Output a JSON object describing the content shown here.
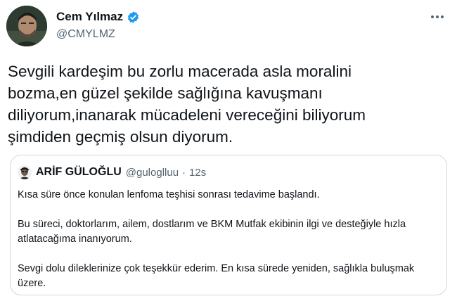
{
  "author": {
    "display_name": "Cem Yılmaz",
    "handle": "@CMYLMZ",
    "avatar_icon": "profile-photo",
    "verified_icon": "verified-badge-icon"
  },
  "more_icon": "more-options-icon",
  "tweet_text": "Sevgili kardeşim bu zorlu macerada asla moralini\nbozma,en güzel şekilde sağlığına kavuşmanı\ndiliyorum,inanarak mücadeleni vereceğini biliyorum\nşimdiden geçmiş olsun diyorum.",
  "quoted": {
    "display_name": "ARİF GÜLOĞLU",
    "handle": "@guloglluu",
    "separator": "·",
    "time": "12s",
    "paragraphs": [
      "Kısa süre önce konulan lenfoma teşhisi sonrası tedavime başlandı.",
      "Bu süreci, doktorlarım, ailem, dostlarım ve BKM Mutfak ekibinin ilgi ve desteğiyle hızla atlatacağıma inanıyorum.",
      "Sevgi dolu dileklerinize çok teşekkür ederim. En kısa sürede yeniden, sağlıkla buluşmak üzere."
    ]
  },
  "colors": {
    "verified_blue": "#1d9bf0",
    "secondary_text": "#536471",
    "border": "#cfd9de"
  }
}
